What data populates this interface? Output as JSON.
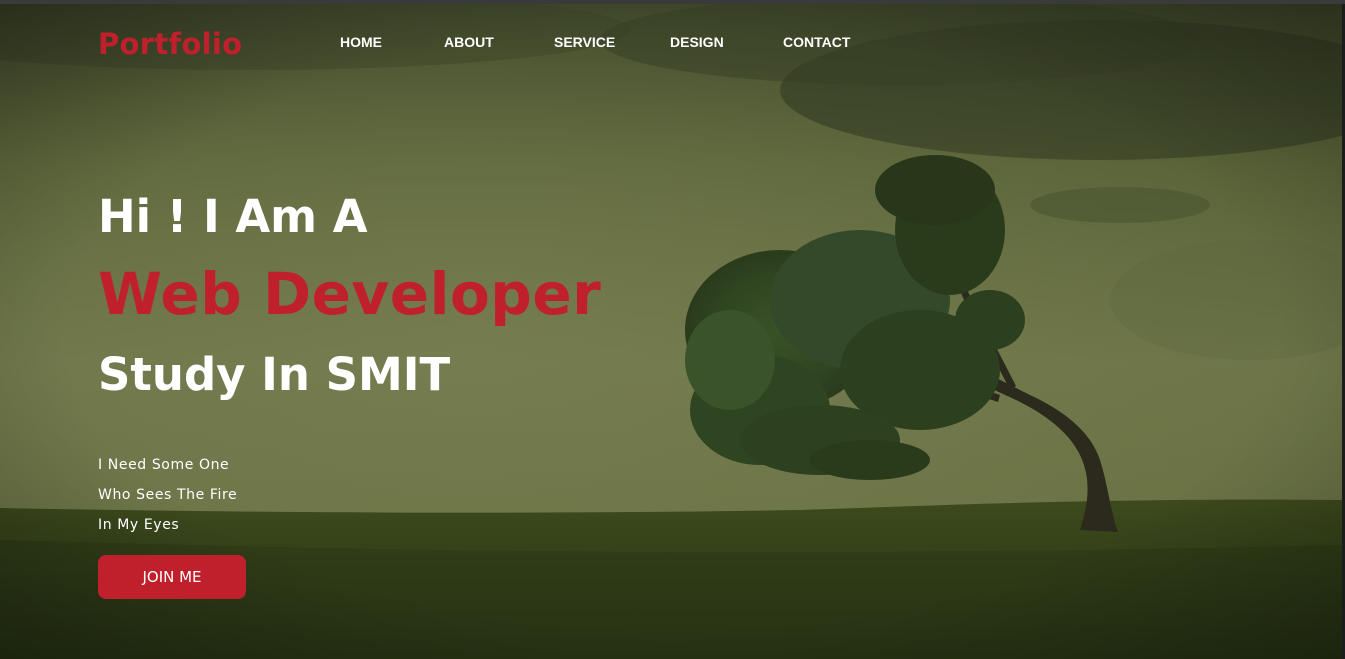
{
  "brand": {
    "logo_text": "Portfolio",
    "accent_color": "#c0202b"
  },
  "nav": {
    "items": [
      {
        "label": "HOME"
      },
      {
        "label": "ABOUT"
      },
      {
        "label": "SERVICE"
      },
      {
        "label": "DESIGN"
      },
      {
        "label": "CONTACT"
      }
    ]
  },
  "hero": {
    "line1": "Hi ! I Am A",
    "line2": "Web Developer",
    "line3": "Study In SMIT",
    "tagline": [
      "I Need Some One",
      "Who Sees The Fire",
      "In My Eyes"
    ],
    "cta_label": "JOIN ME",
    "background_image": "lone-tree-on-grassy-hill"
  }
}
